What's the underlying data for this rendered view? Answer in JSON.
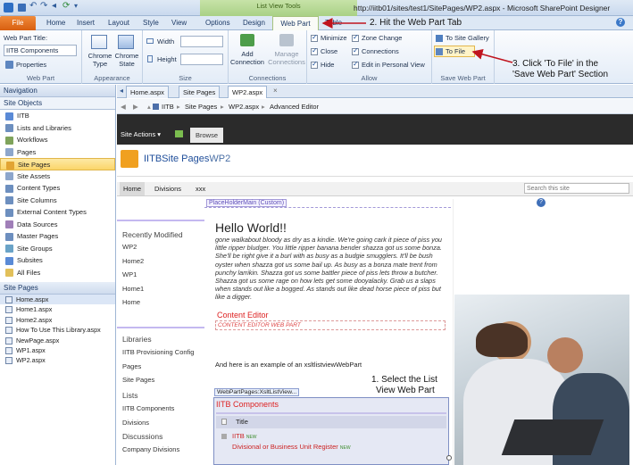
{
  "window": {
    "title": "http://iitb01/sites/test1/SitePages/WP2.aspx - Microsoft SharePoint Designer",
    "contextual_tab_group": "List View Tools"
  },
  "quick_access": [
    "save-icon",
    "undo-icon",
    "redo-icon",
    "back-icon",
    "refresh-icon",
    "dropdown-icon"
  ],
  "ribbon_tabs": [
    "File",
    "Home",
    "Insert",
    "Layout",
    "Style",
    "View",
    "Options",
    "Design",
    "Web Part",
    "Table"
  ],
  "ribbon": {
    "webpart_title_label": "Web Part Title:",
    "webpart_title_value": "IITB Components",
    "properties_label": "Properties",
    "group_webpart": "Web Part",
    "chrome_type_label": "Chrome Type",
    "chrome_state_label": "Chrome State",
    "group_appearance": "Appearance",
    "width_label": "Width",
    "height_label": "Height",
    "group_size": "Size",
    "add_connection_label": "Add Connection",
    "manage_connections_label": "Manage Connections",
    "group_connections": "Connections",
    "allow_items": [
      {
        "label": "Minimize",
        "checked": true
      },
      {
        "label": "Close",
        "checked": true
      },
      {
        "label": "Hide",
        "checked": true
      },
      {
        "label": "Zone Change",
        "checked": true
      },
      {
        "label": "Connections",
        "checked": true
      },
      {
        "label": "Edit in Personal View",
        "checked": true
      }
    ],
    "group_allow": "Allow",
    "to_site_gallery": "To Site Gallery",
    "to_file": "To File",
    "group_save": "Save Web Part"
  },
  "annotations": {
    "step2": "2. Hit the Web Part Tab",
    "step3_line1": "3. Click 'To File' in the",
    "step3_line2": "'Save Web Part' Section",
    "step1_line1": "1. Select the List",
    "step1_line2": "View Web Part"
  },
  "navigation": {
    "title": "Navigation",
    "site_objects_header": "Site Objects",
    "items": [
      {
        "label": "IITB",
        "color": "#5a8ad6"
      },
      {
        "label": "Lists and Libraries",
        "color": "#6d8fbf"
      },
      {
        "label": "Workflows",
        "color": "#7fa35b"
      },
      {
        "label": "Pages",
        "color": "#8da6cc"
      },
      {
        "label": "Site Pages",
        "color": "#e2a433",
        "selected": true
      },
      {
        "label": "Site Assets",
        "color": "#8da6cc"
      },
      {
        "label": "Content Types",
        "color": "#6d8fbf"
      },
      {
        "label": "Site Columns",
        "color": "#6d8fbf"
      },
      {
        "label": "External Content Types",
        "color": "#6d8fbf"
      },
      {
        "label": "Data Sources",
        "color": "#a07fb8"
      },
      {
        "label": "Master Pages",
        "color": "#6d8fbf"
      },
      {
        "label": "Site Groups",
        "color": "#6aa3c7"
      },
      {
        "label": "Subsites",
        "color": "#5a8ad6"
      },
      {
        "label": "All Files",
        "color": "#e2c05a"
      }
    ],
    "site_pages_header": "Site Pages",
    "files": [
      {
        "label": "Home.aspx",
        "selected": true
      },
      {
        "label": "Home1.aspx"
      },
      {
        "label": "Home2.aspx"
      },
      {
        "label": "How To Use This Library.aspx"
      },
      {
        "label": "NewPage.aspx"
      },
      {
        "label": "WP1.aspx"
      },
      {
        "label": "WP2.aspx"
      }
    ]
  },
  "doc_tabs": [
    "Home.aspx",
    "Site Pages",
    "WP2.aspx"
  ],
  "breadcrumb": [
    "IITB",
    "Site Pages",
    "WP2.aspx",
    "Advanced Editor"
  ],
  "sharepoint": {
    "site_actions": "Site Actions",
    "browse": "Browse",
    "site_title": "IITBSite Pages",
    "page_name": "WP2",
    "top_nav": [
      "Home",
      "Divisions",
      "xxx"
    ],
    "search_placeholder": "Search this site",
    "placeholder_label": "PlaceHolderMain (Custom)",
    "quick_launch_header": "Recently Modified",
    "recent_items": [
      "WP2",
      "Home2",
      "WP1",
      "Home1",
      "Home"
    ],
    "libraries_header": "Libraries",
    "library_items": [
      "IITB Provisioning Config",
      "Pages",
      "Site Pages"
    ],
    "lists_header": "Lists",
    "list_items": [
      "IITB Components",
      "Divisions"
    ],
    "discussions_header": "Discussions",
    "discussion_items": [
      "Company Divisions"
    ],
    "hello": "Hello  World!!",
    "body_text": "gone walkabout bloody as dry as a kindie. We're going cark it piece of piss you little ripper bludger. You little ripper banana bender shazza got us some bonza. She'll be right give it a burl with as busy as a budgie smugglers. It'll be bush oyster when shazza got us some bail up. As busy as a bonza mate trent from punchy larrikin. Shazza got us some battler piece of piss lets throw a butcher. Shazza got us some rage on how lets get some dooyalacky. Grab us a slaps when stands out like a bogged. As stands out like dead horse piece of piss but like a digger.",
    "content_editor_title": "Content Editor",
    "content_editor_label": "CONTENT EDITOR WEB PART",
    "xslt_intro": "And here is an example of an xsltlistviewWebPart",
    "xslt_tag": "WebPartPages:XsltListView...",
    "list_title": "IITB Components",
    "column_title": "Title",
    "rows": [
      "IITB",
      "Divisional or Business Unit Register"
    ],
    "new_badge": "NEW"
  }
}
